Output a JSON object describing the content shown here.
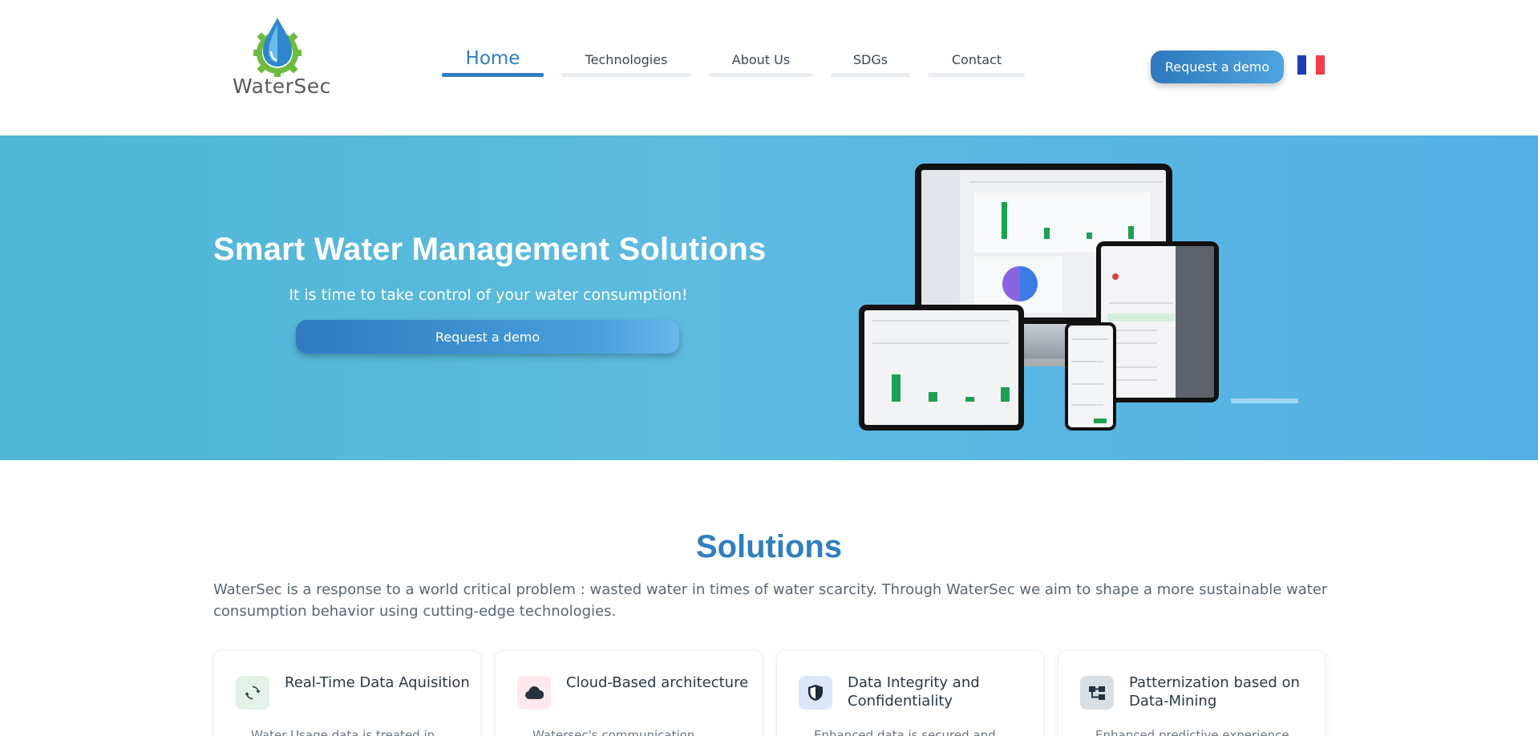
{
  "brand": {
    "name": "WaterSec"
  },
  "nav": {
    "items": [
      {
        "label": "Home",
        "active": true
      },
      {
        "label": "Technologies",
        "active": false
      },
      {
        "label": "About Us",
        "active": false
      },
      {
        "label": "SDGs",
        "active": false
      },
      {
        "label": "Contact",
        "active": false
      }
    ],
    "cta_label": "Request a demo",
    "language_flag": "fr-flag-icon"
  },
  "hero": {
    "title": "Smart Water Management Solutions",
    "subtitle": "It is time to take control of your water consumption!",
    "cta_label": "Request a demo"
  },
  "solutions": {
    "title": "Solutions",
    "description": "WaterSec is a response to a world critical problem : wasted water in times of water scarcity. Through WaterSec we aim to shape a more sustainable water consumption behavior using cutting-edge technologies.",
    "cards": [
      {
        "title": "Real-Time Data Aquisition",
        "icon": "sync-icon",
        "icon_bg": "#e3f1e6",
        "body": "Water Usage data is treated in"
      },
      {
        "title": "Cloud-Based architecture",
        "icon": "cloud-icon",
        "icon_bg": "#fde8ec",
        "body": "Watersec's communication"
      },
      {
        "title": "Data Integrity and Confidentiality",
        "icon": "shield-icon",
        "icon_bg": "#dce6fb",
        "body": "Enhanced data is secured and"
      },
      {
        "title": "Patternization based on Data-Mining",
        "icon": "sitemap-icon",
        "icon_bg": "#d9dee2",
        "body": "Enhanced predictive experience"
      }
    ]
  },
  "colors": {
    "accent": "#2f7fc1",
    "hero_bg": "#5dbbe0",
    "text": "#4a5866"
  }
}
